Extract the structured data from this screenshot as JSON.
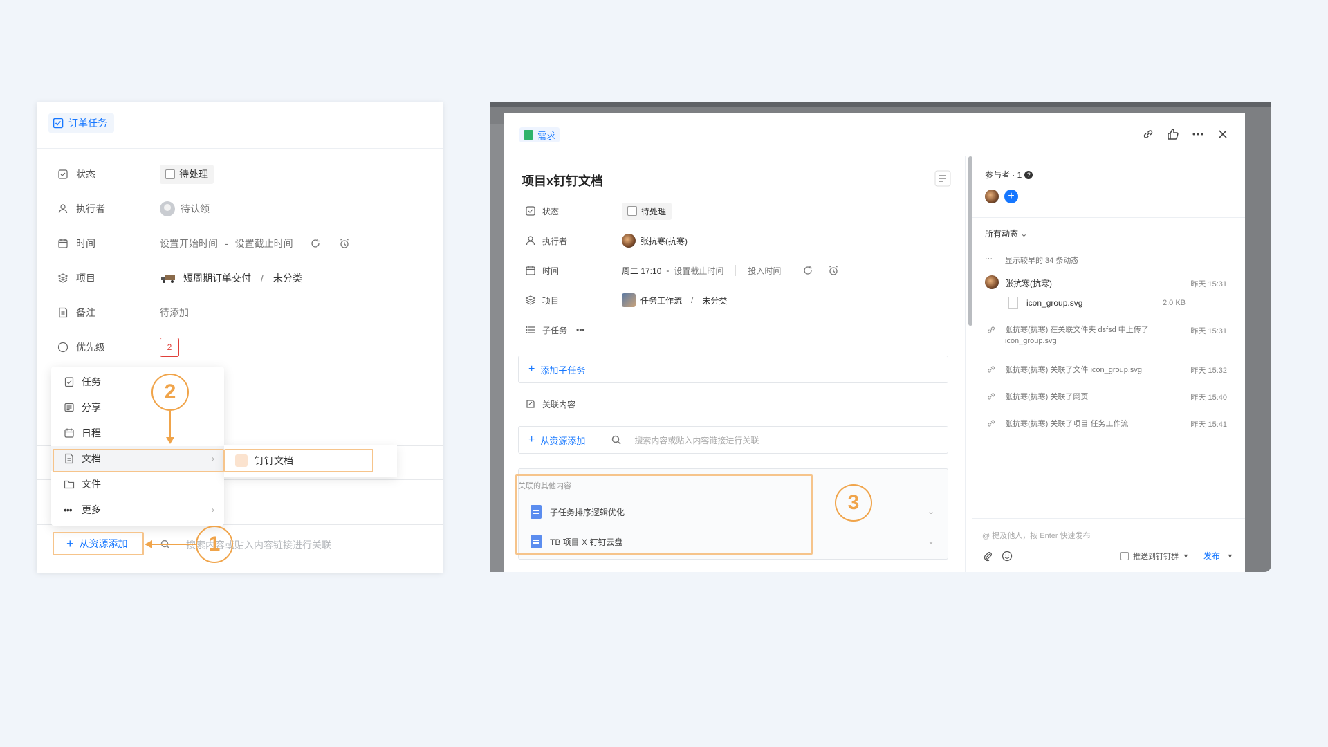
{
  "left": {
    "tab_label": "订单任务",
    "fields": {
      "status": {
        "label": "状态",
        "value": "待处理"
      },
      "assignee": {
        "label": "执行者",
        "value": "待认领"
      },
      "time": {
        "label": "时间",
        "start": "设置开始时间",
        "dash": "-",
        "end": "设置截止时间"
      },
      "project": {
        "label": "项目",
        "name": "短周期订单交付",
        "slash": "/",
        "category": "未分类"
      },
      "note": {
        "label": "备注",
        "value": "待添加"
      },
      "priority": {
        "label": "优先级",
        "value": "2"
      }
    },
    "menu": {
      "items": [
        {
          "label": "任务"
        },
        {
          "label": "分享"
        },
        {
          "label": "日程"
        },
        {
          "label": "文档"
        },
        {
          "label": "文件"
        },
        {
          "label": "更多"
        }
      ],
      "submenu_item": "钉钉文档"
    },
    "add_from_resource": "从资源添加",
    "search_placeholder": "搜索内容或贴入内容链接进行关联"
  },
  "annotations": {
    "badge1": "1",
    "badge2": "2",
    "badge3": "3",
    "color": "#f0a44a"
  },
  "right": {
    "tag": "需求",
    "title": "项目x钉钉文档",
    "fields": {
      "status": {
        "label": "状态",
        "value": "待处理"
      },
      "assignee": {
        "label": "执行者",
        "value": "张抗寒(抗寒)"
      },
      "time": {
        "label": "时间",
        "start": "周二 17:10",
        "dash": "-",
        "end": "设置截止时间",
        "invest": "投入时间"
      },
      "project": {
        "label": "项目",
        "name": "任务工作流",
        "slash": "/",
        "category": "未分类"
      },
      "subtask": {
        "label": "子任务",
        "more": "•••"
      }
    },
    "add_subtask": "添加子任务",
    "related": {
      "label": "关联内容",
      "add": "从资源添加",
      "search_placeholder": "搜索内容或贴入内容链接进行关联"
    },
    "related_other": {
      "title": "关联的其他内容",
      "items": [
        {
          "label": "子任务排序逻辑优化"
        },
        {
          "label": "TB 项目 X 钉钉云盘"
        }
      ]
    },
    "sidebar": {
      "participants": "参与者 · 1",
      "activity_filter": "所有动态",
      "show_earlier": "显示较早的 34 条动态",
      "entries": [
        {
          "user": "张抗寒(抗寒)",
          "time": "昨天 15:31",
          "file": "icon_group.svg",
          "size": "2.0 KB"
        },
        {
          "text": "张抗寒(抗寒) 在关联文件夹 dsfsd 中上传了",
          "text2": "icon_group.svg",
          "time": "昨天 15:31"
        },
        {
          "text": "张抗寒(抗寒) 关联了文件 icon_group.svg",
          "time": "昨天 15:32"
        },
        {
          "text": "张抗寒(抗寒) 关联了网页",
          "time": "昨天 15:40"
        },
        {
          "text": "张抗寒(抗寒) 关联了项目 任务工作流",
          "time": "昨天 15:41"
        }
      ],
      "comment_placeholder": "@ 提及他人，按 Enter 快速发布",
      "push_label": "推送到钉钉群",
      "publish": "发布"
    }
  }
}
